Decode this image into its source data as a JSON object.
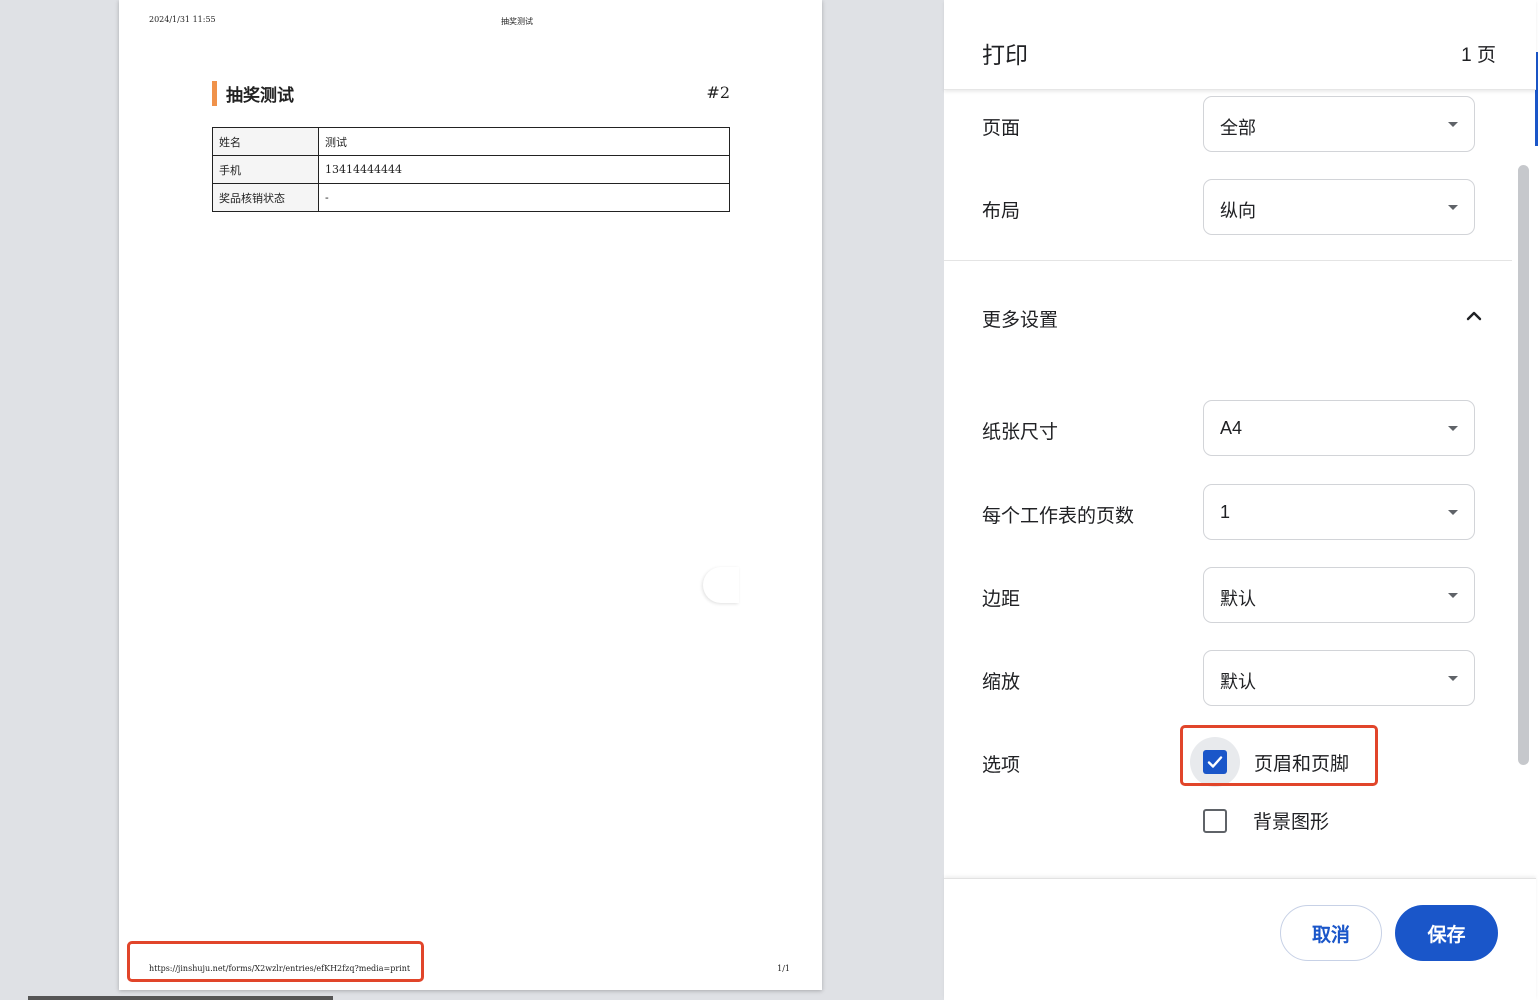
{
  "preview": {
    "header_date": "2024/1/31 11:55",
    "header_title": "抽奖测试",
    "doc_title": "抽奖测试",
    "entry_number": "#2",
    "table_rows": [
      {
        "key": "姓名",
        "value": "测试"
      },
      {
        "key": "手机",
        "value": "13414444444"
      },
      {
        "key": "奖品核销状态",
        "value": "-"
      }
    ],
    "footer_url": "https://jinshuju.net/forms/X2wzlr/entries/efKH2fzq?media=print",
    "footer_page": "1/1",
    "accent_color": "#f0924a"
  },
  "dialog": {
    "title": "打印",
    "page_count": "1 页",
    "settings": {
      "pages": {
        "label": "页面",
        "value": "全部"
      },
      "layout": {
        "label": "布局",
        "value": "纵向"
      },
      "more_settings": "更多设置",
      "paper_size": {
        "label": "纸张尺寸",
        "value": "A4"
      },
      "pages_per_sheet": {
        "label": "每个工作表的页数",
        "value": "1"
      },
      "margins": {
        "label": "边距",
        "value": "默认"
      },
      "scale": {
        "label": "缩放",
        "value": "默认"
      },
      "options": {
        "label": "选项",
        "headers_footers": {
          "label": "页眉和页脚",
          "checked": true
        },
        "background_graphics": {
          "label": "背景图形",
          "checked": false
        }
      }
    },
    "buttons": {
      "cancel": "取消",
      "save": "保存"
    },
    "primary_color": "#1a56c9",
    "highlight_color": "#e1452a"
  }
}
